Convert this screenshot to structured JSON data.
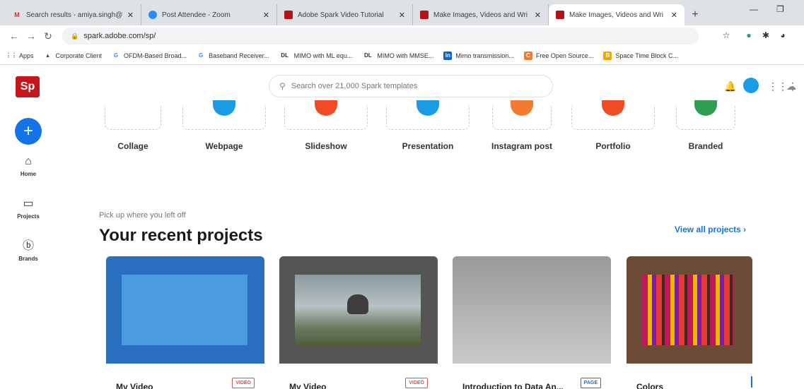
{
  "browser": {
    "tabs": [
      {
        "title": "Search results - amiya.singh@",
        "icon": "gmail-icon",
        "active": false
      },
      {
        "title": "Post Attendee - Zoom",
        "icon": "zoom-icon",
        "active": false
      },
      {
        "title": "Adobe Spark Video Tutorial",
        "icon": "spark-icon",
        "active": false
      },
      {
        "title": "Make Images, Videos and Wri",
        "icon": "spark-icon",
        "active": false
      },
      {
        "title": "Make Images, Videos and Wri",
        "icon": "spark-icon",
        "active": true
      }
    ],
    "url": "spark.adobe.com/sp/",
    "bookmarks": [
      {
        "label": "Apps"
      },
      {
        "label": "Corporate Client"
      },
      {
        "label": "OFDM-Based Broad..."
      },
      {
        "label": "Baseband Receiver..."
      },
      {
        "label": "MIMO with ML equ..."
      },
      {
        "label": "MIMO with MMSE..."
      },
      {
        "label": "Mimo transmission..."
      },
      {
        "label": "Free Open Source..."
      },
      {
        "label": "Space Time Block C..."
      }
    ]
  },
  "app": {
    "logo": "Sp",
    "search_placeholder": "Search over 21,000 Spark templates",
    "sidebar": [
      {
        "label": "Home",
        "icon": "home-icon"
      },
      {
        "label": "Projects",
        "icon": "folder-icon"
      },
      {
        "label": "Brands",
        "icon": "brand-icon"
      }
    ],
    "templates": [
      {
        "label": "Collage",
        "color": ""
      },
      {
        "label": "Webpage",
        "color": "#1a9be6"
      },
      {
        "label": "Slideshow",
        "color": "#f04b23"
      },
      {
        "label": "Presentation",
        "color": "#1a9be6"
      },
      {
        "label": "Instagram post",
        "color": "#f47a30"
      },
      {
        "label": "Portfolio",
        "color": "#f04b23"
      },
      {
        "label": "Branded",
        "color": "#2f9e52"
      }
    ],
    "recent_sub": "Pick up where you left off",
    "recent_title": "Your recent projects",
    "view_all": "View all projects ›",
    "projects": [
      {
        "name": "My Video",
        "badge": "VIDEO"
      },
      {
        "name": "My Video",
        "badge": "VIDEO"
      },
      {
        "name": "Introduction to Data An...",
        "badge": "PAGE"
      },
      {
        "name": "Colors",
        "badge": ""
      }
    ]
  }
}
